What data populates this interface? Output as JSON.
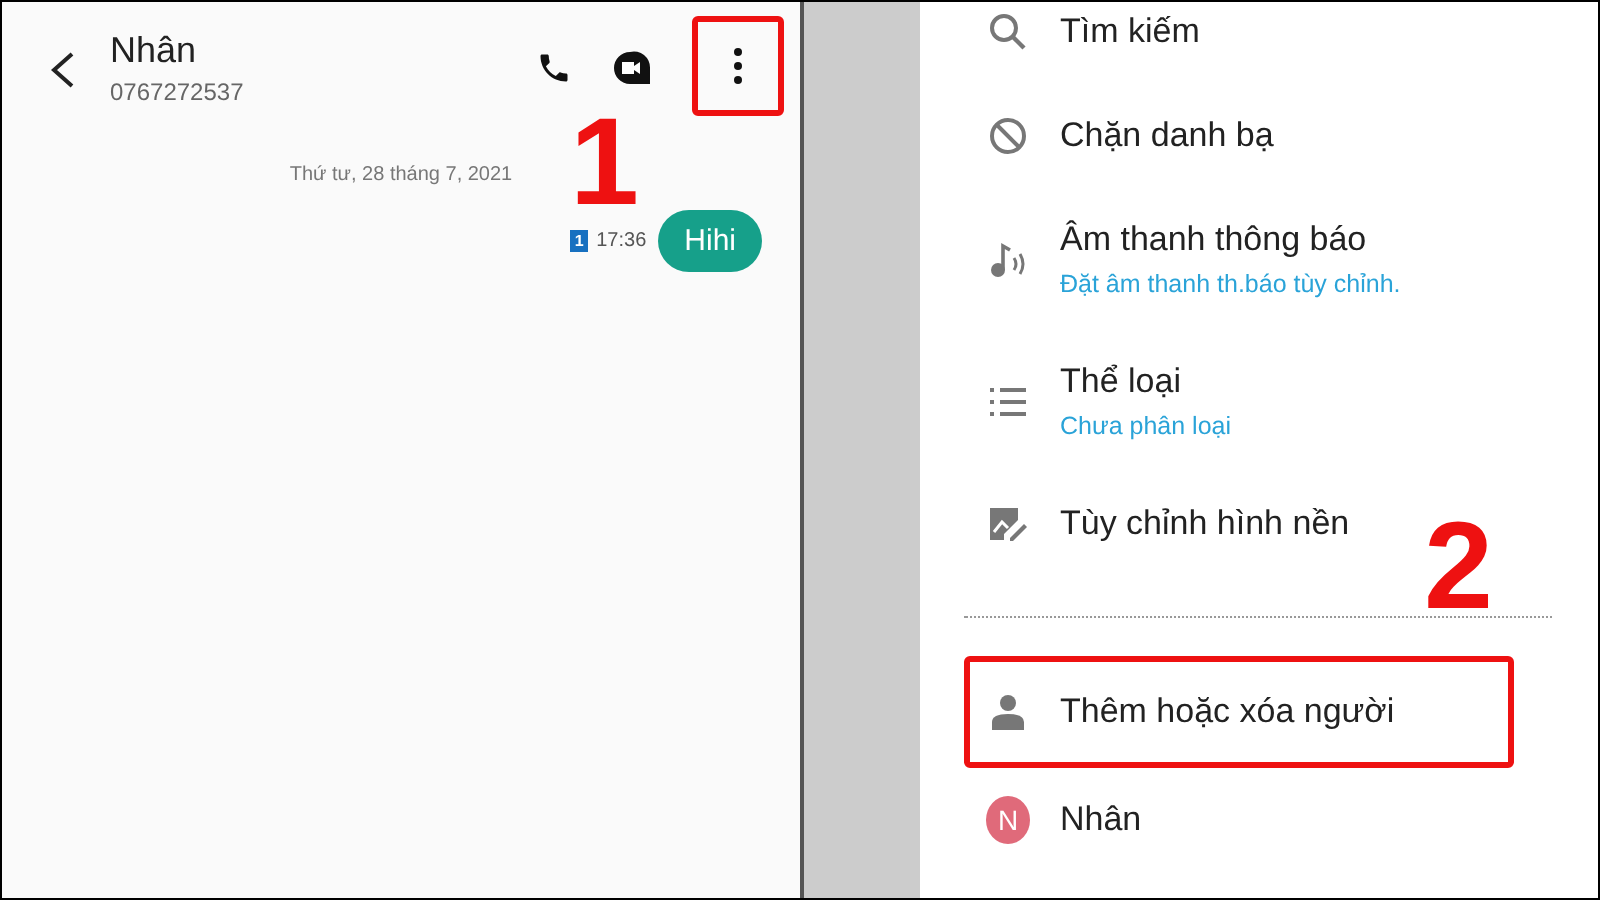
{
  "conversation": {
    "contact_name": "Nhân",
    "phone_number": "0767272537",
    "more_button": {
      "highlighted": true
    },
    "step_label": "1",
    "date_separator": "Thứ tư, 28 tháng 7, 2021",
    "messages": [
      {
        "sim_slot": "1",
        "time": "17:36",
        "text": "Hihi"
      }
    ]
  },
  "menu": {
    "step_label": "2",
    "items": [
      {
        "kind": "search",
        "title": "Tìm kiếm",
        "highlighted": false
      },
      {
        "kind": "block",
        "title": "Chặn danh bạ",
        "highlighted": false
      },
      {
        "kind": "sound",
        "title": "Âm thanh thông báo",
        "subtitle": "Đặt âm thanh th.báo tùy chỉnh.",
        "highlighted": false
      },
      {
        "kind": "category",
        "title": "Thể loại",
        "subtitle": "Chưa phân loại",
        "highlighted": false
      },
      {
        "kind": "wallpaper",
        "title": "Tùy chỉnh hình nền",
        "highlighted": false
      },
      {
        "kind": "divider"
      },
      {
        "kind": "person",
        "title": "Thêm hoặc xóa người",
        "highlighted": true
      },
      {
        "kind": "contact",
        "initial": "N",
        "title": "Nhân",
        "highlighted": false
      }
    ]
  }
}
